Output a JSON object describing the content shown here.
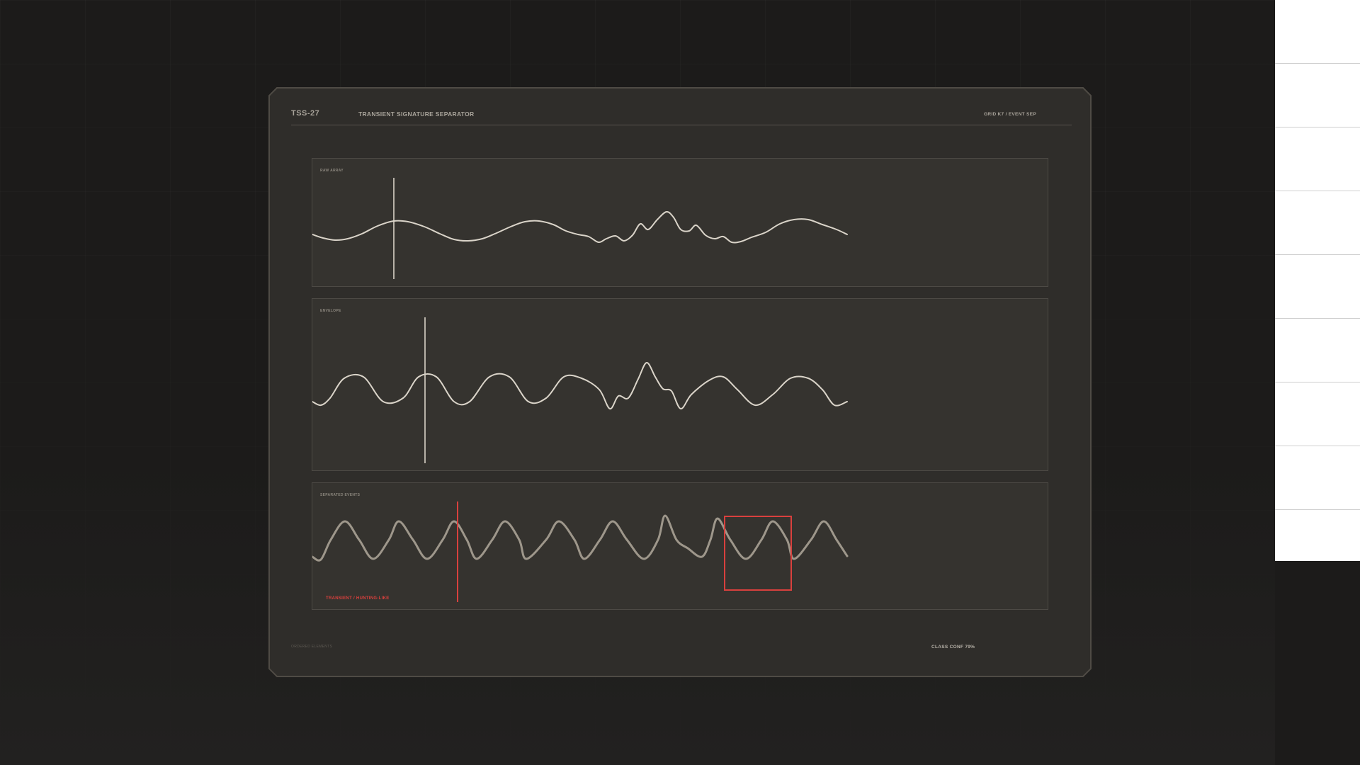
{
  "header": {
    "device_id": "TSS-27",
    "title": "TRANSIENT SIGNATURE SEPARATOR",
    "grid_label": "GRID K7 / EVENT SEP"
  },
  "panels": [
    {
      "label": "RAW ARRAY"
    },
    {
      "label": "ENVELOPE"
    },
    {
      "label": "SEPARATED EVENTS"
    }
  ],
  "classification": {
    "label": "TRANSIENT / HUNTING-LIKE",
    "confidence_text": "CLASS CONF 79%",
    "confidence_value": 0.79
  },
  "footer": {
    "left_text": "ORDERED ELEMENTS"
  },
  "colors": {
    "waveform": "#dad4c9",
    "events_waveform": "#9e978b",
    "marker": "#b8b2a8",
    "alert": "#d9403d",
    "panel_bg": "#35332f",
    "device_bg": "#2f2d2a"
  }
}
